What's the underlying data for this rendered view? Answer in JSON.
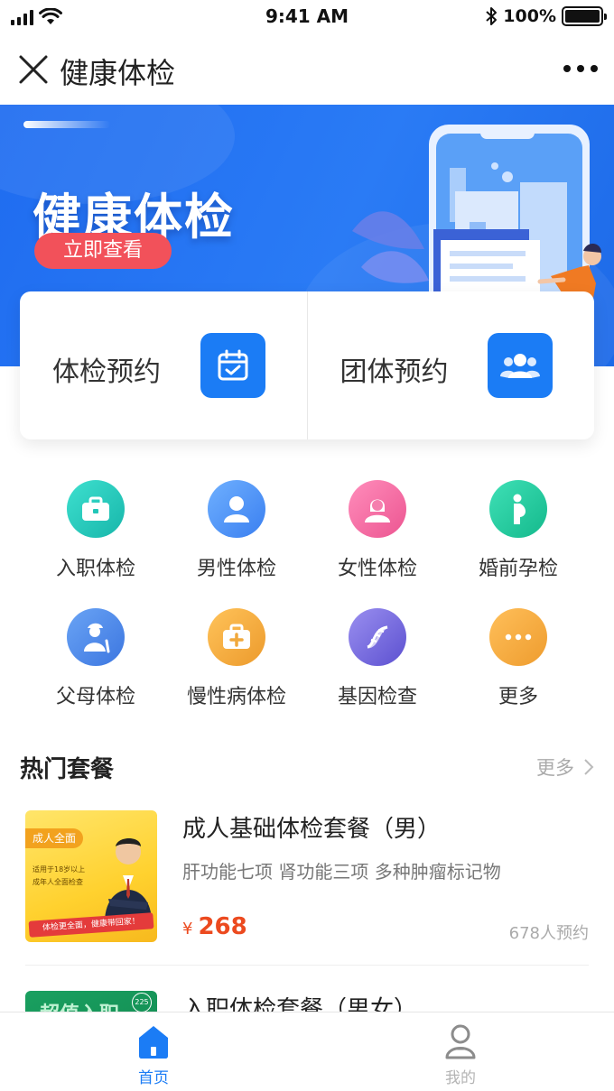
{
  "status_bar": {
    "time": "9:41 AM",
    "battery": "100%"
  },
  "nav": {
    "title": "健康体检"
  },
  "banner": {
    "title": "健康体检",
    "button": "立即查看"
  },
  "booking": [
    {
      "label": "体检预约",
      "icon": "calendar-check-icon"
    },
    {
      "label": "团体预约",
      "icon": "group-users-icon"
    }
  ],
  "categories": [
    {
      "label": "入职体检",
      "icon": "briefcase-icon",
      "color": "#22c6b8"
    },
    {
      "label": "男性体检",
      "icon": "male-user-icon",
      "color": "#4f8ff2"
    },
    {
      "label": "女性体检",
      "icon": "female-user-icon",
      "color": "#f06aa0"
    },
    {
      "label": "婚前孕检",
      "icon": "pregnant-icon",
      "color": "#20c49a"
    },
    {
      "label": "父母体检",
      "icon": "elderly-icon",
      "color": "#4a86e8"
    },
    {
      "label": "慢性病体检",
      "icon": "medical-kit-icon",
      "color": "#f1a93d"
    },
    {
      "label": "基因检查",
      "icon": "dna-icon",
      "color": "#7b6fe0"
    },
    {
      "label": "更多",
      "icon": "more-dots-icon",
      "color": "#f2a93a"
    }
  ],
  "hot": {
    "title": "热门套餐",
    "more": "更多",
    "packages": [
      {
        "title": "成人基础体检套餐（男）",
        "desc": "肝功能七项 肾功能三项 多种肿瘤标记物",
        "currency": "¥",
        "price": "268",
        "count": "678人预约",
        "thumb": {
          "tag": "成人全面",
          "line1": "适用于18岁以上",
          "line2": "成年人全面检查",
          "ribbon": "体检更全面，健康带回家！"
        }
      },
      {
        "title": "入职体检套餐（男女）",
        "thumb": {
          "tag": "超值入职",
          "badge": "225"
        }
      }
    ]
  },
  "tabs": [
    {
      "label": "首页",
      "active": true,
      "color": "#1b7cf5"
    },
    {
      "label": "我的",
      "active": false,
      "color": "#b4b4b4"
    }
  ]
}
